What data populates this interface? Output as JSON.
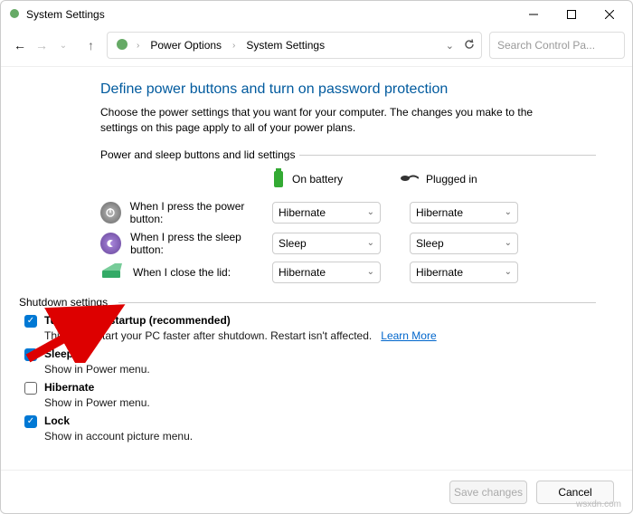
{
  "titlebar": {
    "title": "System Settings"
  },
  "nav": {
    "breadcrumb": [
      "Power Options",
      "System Settings"
    ],
    "search_placeholder": "Search Control Pa..."
  },
  "main": {
    "heading": "Define power buttons and turn on password protection",
    "description": "Choose the power settings that you want for your computer. The changes you make to the settings on this page apply to all of your power plans.",
    "section_power_label": "Power and sleep buttons and lid settings",
    "columns": {
      "battery": "On battery",
      "plugged": "Plugged in"
    },
    "rows": [
      {
        "label": "When I press the power button:",
        "battery": "Hibernate",
        "plugged": "Hibernate"
      },
      {
        "label": "When I press the sleep button:",
        "battery": "Sleep",
        "plugged": "Sleep"
      },
      {
        "label": "When I close the lid:",
        "battery": "Hibernate",
        "plugged": "Hibernate"
      }
    ],
    "section_shutdown_label": "Shutdown settings",
    "fast_startup": {
      "label": "Turn on fast startup (recommended)",
      "sub": "This helps start your PC faster after shutdown. Restart isn't affected.",
      "learn_more": "Learn More",
      "checked": true
    },
    "sleep_opt": {
      "label": "Sleep",
      "sub": "Show in Power menu.",
      "checked": true
    },
    "hibernate_opt": {
      "label": "Hibernate",
      "sub": "Show in Power menu.",
      "checked": false
    },
    "lock_opt": {
      "label": "Lock",
      "sub": "Show in account picture menu.",
      "checked": true
    }
  },
  "footer": {
    "save": "Save changes",
    "cancel": "Cancel"
  },
  "watermark": "wsxdn.com"
}
